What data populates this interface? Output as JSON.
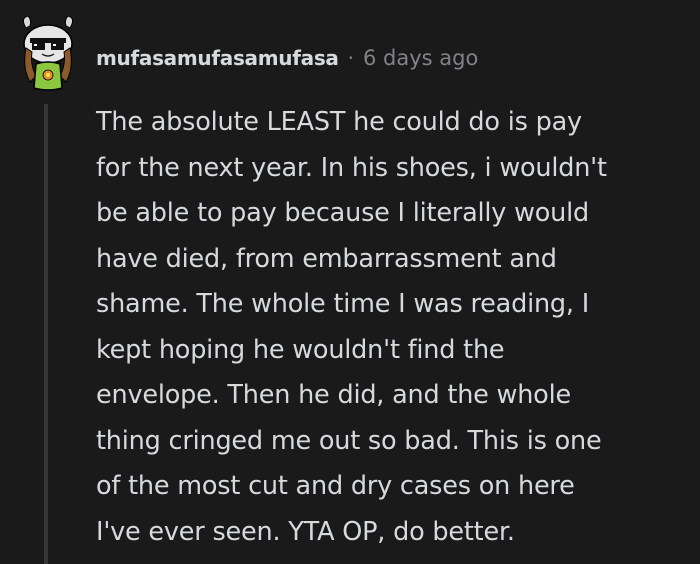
{
  "comment": {
    "author": "mufasamufasamufasa",
    "separator": "·",
    "timestamp": "6 days ago",
    "body_lines": [
      "The absolute LEAST he could do is pay",
      "for the next year. In his shoes, i wouldn't",
      "be able to pay because I literally would",
      "have died, from embarrassment and",
      "shame. The whole time I was reading, I",
      "kept hoping he wouldn't find the",
      "envelope. Then he did, and the whole",
      "thing cringed me out so bad. This is one",
      "of the most cut and dry cases on here",
      "I've ever seen. YTA OP, do better."
    ]
  },
  "avatar": {
    "icon": "snoo-avatar-with-pixel-sunglasses",
    "colors": {
      "head": "#e6e6e6",
      "sunglasses": "#111111",
      "hair": "#8b5a2b",
      "shirt": "#8dc63f",
      "flower": "#f28c28",
      "horns": "#d9d9d9"
    }
  },
  "theme": {
    "background": "#1a1a1b",
    "text": "#d7dadc",
    "muted": "#818384",
    "thread_line": "#343536"
  }
}
